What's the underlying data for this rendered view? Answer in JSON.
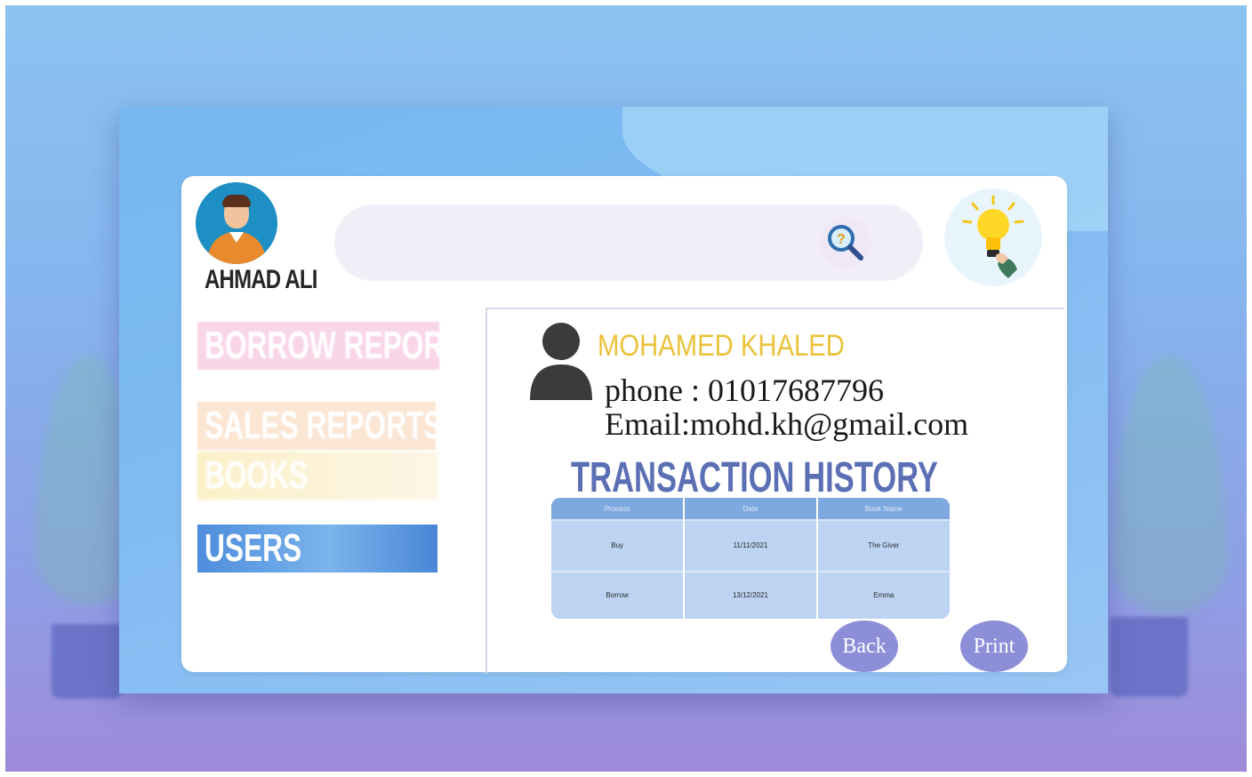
{
  "current_user": {
    "name": "AHMAD ALI"
  },
  "sidebar": {
    "items": [
      {
        "label": "BORROW REPORTS"
      },
      {
        "label": "SALES REPORTS"
      },
      {
        "label": "BOOKS"
      },
      {
        "label": "USERS"
      }
    ]
  },
  "search": {
    "placeholder": ""
  },
  "customer": {
    "name": "MOHAMED KHALED",
    "phone": "phone : 01017687796",
    "email": "Email:mohd.kh@gmail.com"
  },
  "transactions": {
    "title": "TRANSACTION HISTORY",
    "columns": [
      "Process",
      "Date",
      "Book Name"
    ],
    "rows": [
      [
        "Buy",
        "11/11/2021",
        "The Giver"
      ],
      [
        "Borrow",
        "13/12/2021",
        "Emma"
      ]
    ]
  },
  "actions": {
    "back_label": "Back",
    "print_label": "Print"
  },
  "colors": {
    "accent_yellow": "#eac23a",
    "title_blue": "#5b6fb4",
    "button_purple": "#8c8ed8",
    "users_tab_blue": "#4f8ddc"
  },
  "icons": {
    "search": "search-question-icon",
    "tip": "lightbulb-icon",
    "customer": "person-icon"
  }
}
